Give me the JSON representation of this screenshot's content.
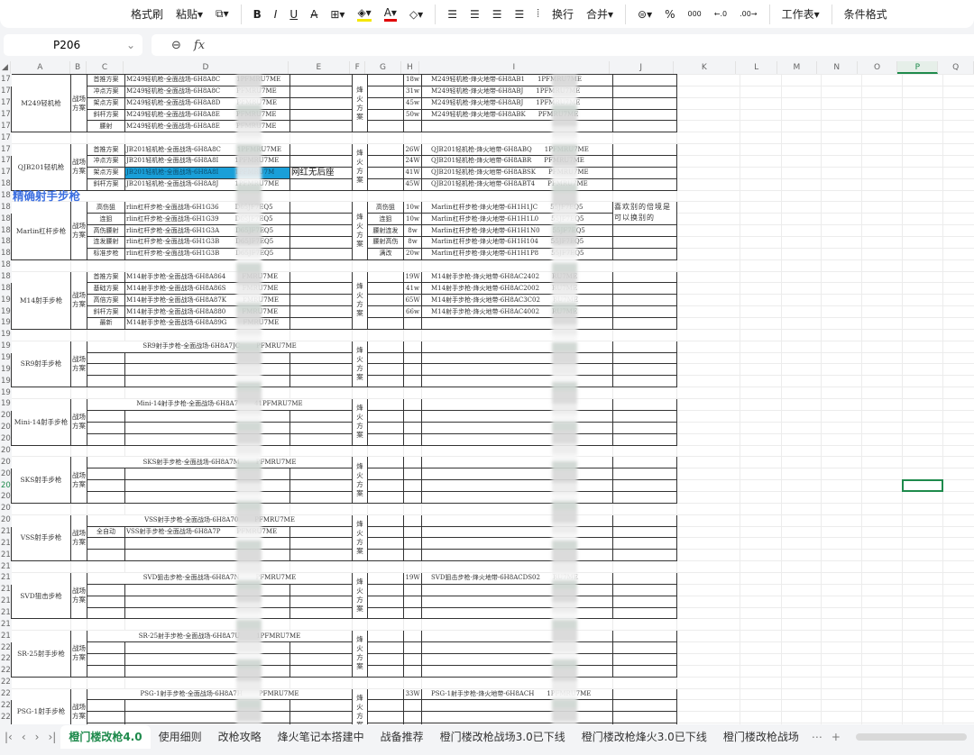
{
  "toolbar": {
    "format_painter": "格式刷",
    "paste": "粘贴▾",
    "copy_icon": "⧉▾",
    "bold": "B",
    "italic": "I",
    "underline": "U",
    "strike": "A̶",
    "border": "⊞▾",
    "fill": "◈▾",
    "font_color": "A▾",
    "clear": "◇▾",
    "align_left": "☰",
    "align_center": "☰",
    "align_right": "☰",
    "justify": "☰",
    "distributed": "⦙",
    "wrap": "换行",
    "merge": "合并▾",
    "number_format": "⊜▾",
    "percent": "%",
    "thousands": "000",
    "inc_decimal": "←.0",
    "dec_decimal": ".00→",
    "worksheet": "工作表▾",
    "conditional_format": "条件格式"
  },
  "formula_bar": {
    "cell_ref": "P206",
    "dropdown": "⌄",
    "zoom_icon": "⊖",
    "fx": "fx",
    "value": ""
  },
  "columns": [
    "A",
    "B",
    "C",
    "D",
    "E",
    "F",
    "G",
    "H",
    "I",
    "J",
    "K",
    "L",
    "M",
    "N",
    "O",
    "P",
    "Q"
  ],
  "selected_column": "P",
  "selected_row": 206,
  "section_title": {
    "row": 181,
    "text": "精确射手步枪"
  },
  "battle_label": "战场方案",
  "beacon_label": "烽火方案",
  "blocks": [
    {
      "name": "M249轻机枪",
      "start": 171,
      "rows": [
        {
          "plan": "首推方案",
          "pre": "M249轻机枪-全面战场-6H8A8C",
          "suf": "1PFMRU7ME",
          "price": "18w",
          "fpre": "M249轻机枪-烽火地带-6H8AB1",
          "fsuf": "1PFMRU7ME"
        },
        {
          "plan": "冲点方案",
          "pre": "M249轻机枪-全面战场-6H8A8C",
          "suf": "PFMRU7ME",
          "price": "31w",
          "fpre": "M249轻机枪-烽火地带-6H8ABJ",
          "fsuf": "1PFMRU7ME"
        },
        {
          "plan": "架点方案",
          "pre": "M249轻机枪-全面战场-6H8A8D",
          "suf": "PFMRU7ME",
          "price": "45w",
          "fpre": "M249轻机枪-烽火地带-6H8ABJ",
          "fsuf": "1PFMRU7ME"
        },
        {
          "plan": "斜杆方案",
          "pre": "M249轻机枪-全面战场-6H8A8E",
          "suf": "PFMRU7ME",
          "price": "50w",
          "fpre": "M249轻机枪-烽火地带-6H8ABK",
          "fsuf": "PFMRU7ME"
        },
        {
          "plan": "腰射",
          "pre": "M249轻机枪-全面战场-6H8A8E",
          "suf": "PFMRU7ME"
        }
      ]
    },
    {
      "name": "QJB201轻机枪",
      "start": 177,
      "rows": [
        {
          "plan": "首推方案",
          "pre": "JB201轻机枪-全面战场-6H8A8C",
          "suf": "1PFMRU7ME",
          "price": "26W",
          "fpre": "QJB201轻机枪-烽火地带-6H8ABQ",
          "fsuf": "1PFMRU7ME"
        },
        {
          "plan": "冲点方案",
          "pre": "JB201轻机枪-全面战场-6H8A8I",
          "suf": "1PFMRU7ME",
          "price": "24W",
          "fpre": "QJB201轻机枪-烽火地带-6H8ABR",
          "fsuf": "PFMRU7ME"
        },
        {
          "plan": "架点方案",
          "pre": "JB201轻机枪-全面战场-6H8A8I",
          "suf": "1PFMRU7M",
          "highlight": true,
          "comment": "网红无后座",
          "price": "41W",
          "fpre": "QJB201轻机枪-烽火地带-6H8ABSK",
          "fsuf": "PFMRU7ME"
        },
        {
          "plan": "斜杆方案",
          "pre": "JB201轻机枪-全面战场-6H8A8J",
          "suf": "1PFMRU7ME",
          "price": "45W",
          "fpre": "QJB201轻机枪-烽火地带-6H8ABT4",
          "fsuf": "PFMRU7ME"
        }
      ]
    },
    {
      "name": "Marlin杠杆步枪",
      "start": 182,
      "note": "喜欢别的倍境是可以换别的",
      "rows": [
        {
          "plan": "高伤狙",
          "pre": "rlin杠杆步枪-全面战场-6H1G36",
          "suf": "D65JF7EQ5",
          "fplan": "高伤狙",
          "price": "10w",
          "fpre": "Marlin杠杆步枪-烽火地带-6H1H1JC",
          "fsuf": "55JF7EQ5"
        },
        {
          "plan": "连狙",
          "pre": "rlin杠杆步枪-全面战场-6H1G39",
          "suf": "D65JF7EQ5",
          "fplan": "连狙",
          "price": "10w",
          "fpre": "Marlin杠杆步枪-烽火地带-6H1H1L0",
          "fsuf": "55JF7EQ5"
        },
        {
          "plan": "高伤腰射",
          "pre": "rlin杠杆步枪-全面战场-6H1G3A",
          "suf": "D65JF7EQ5",
          "fplan": "腰射连发",
          "price": "8w",
          "fpre": "Marlin杠杆步枪-烽火地带-6H1H1N0",
          "fsuf": "55JF7EQ5"
        },
        {
          "plan": "连发腰射",
          "pre": "rlin杠杆步枪-全面战场-6H1G3B",
          "suf": "D65JF7EQ5",
          "fplan": "腰射高伤",
          "price": "8w",
          "fpre": "Marlin杠杆步枪-烽火地带-6H1H104",
          "fsuf": "55JF7EQ5"
        },
        {
          "plan": "标准步枪",
          "pre": "rlin杠杆步枪-全面战场-6H1G3B",
          "suf": "D65JF7EQ5",
          "fplan": "满改",
          "price": "20w",
          "fpre": "Marlin杠杆步枪-烽火地带-6H1H1P8",
          "fsuf": "55JF7EQ5"
        }
      ]
    },
    {
      "name": "M14射手步枪",
      "start": 188,
      "rows": [
        {
          "plan": "首推方案",
          "pre": "M14射手步枪-全面战场-6H8A864",
          "suf": "FMRU7ME",
          "price": "19W",
          "fpre": "M14射手步枪-烽火地带-6H8AC2402",
          "fsuf": "RU7ME"
        },
        {
          "plan": "基础方案",
          "pre": "M14射手步枪-全面战场-6H8A86S",
          "suf": "FMRU7ME",
          "price": "41w",
          "fpre": "M14射手步枪-烽火地带-6H8AC2002",
          "fsuf": "RU7ME"
        },
        {
          "plan": "高倍方案",
          "pre": "M14射手步枪-全面战场-6H8A87K",
          "suf": "FMRU7ME",
          "price": "65W",
          "fpre": "M14射手步枪-烽火地带-6H8AC3C02",
          "fsuf": "RU7ME"
        },
        {
          "plan": "斜杆方案",
          "pre": "M14射手步枪-全面战场-6H8A880",
          "suf": "FMRU7ME",
          "price": "66w",
          "fpre": "M14射手步枪-烽火地带-6H8AC4002",
          "fsuf": "RU7ME"
        },
        {
          "plan": "最新",
          "pre": "M14射手步枪-全面战场-6H8A89G",
          "suf": "FMRU7ME"
        }
      ]
    },
    {
      "name": "SR9射手步枪",
      "start": 194,
      "rows": [
        {
          "merged": true,
          "pre": "SR9射手步枪-全面战场-6H8A7JC",
          "suf": "PFMRU7ME"
        },
        {},
        {},
        {}
      ]
    },
    {
      "name": "Mini-14射手步枪",
      "start": 199,
      "rows": [
        {
          "merged": true,
          "pre": "Mini-14射手步枪-全面战场-6H8A7",
          "suf": "41PFMRU7ME"
        },
        {},
        {},
        {}
      ]
    },
    {
      "name": "SKS射手步枪",
      "start": 204,
      "rows": [
        {
          "merged": true,
          "pre": "SKS射手步枪-全面战场-6H8A7M",
          "suf": "PFMRU7ME"
        },
        {},
        {},
        {}
      ]
    },
    {
      "name": "VSS射手步枪",
      "start": 209,
      "rows": [
        {
          "merged": true,
          "pre": "VSS射手步枪-全面战场-6H8A70",
          "suf": "PFMRU7ME"
        },
        {
          "plan": "全自动",
          "pre": "VSS射手步枪-全面战场-6H8A7P",
          "suf": "PFMRU7ME"
        },
        {},
        {}
      ]
    },
    {
      "name": "SVD狙击步枪",
      "start": 214,
      "rows": [
        {
          "merged": true,
          "pre": "SVD狙击步枪-全面战场-6H8A7N",
          "suf": "PFMRU7ME",
          "price": "19W",
          "fpre": "SVD狙击步枪-烽火地带-6H8ACDS02",
          "fsuf": "RU7ME"
        },
        {},
        {},
        {}
      ]
    },
    {
      "name": "SR-25射手步枪",
      "start": 219,
      "rows": [
        {
          "merged": true,
          "pre": "SR-25射手步枪-全面战场-6H8A7U",
          "suf": "1PFMRU7ME"
        },
        {},
        {},
        {}
      ]
    },
    {
      "name": "PSG-1射手步枪",
      "start": 224,
      "rows": [
        {
          "merged": true,
          "pre": "PSG-1射手步枪-全面战场-6H8A7H",
          "suf": "PFMRU7ME",
          "price": "33W",
          "fpre": "PSG-1射手步枪-烽火地带-6H8ACH",
          "fsuf": "1PFMRU7ME"
        },
        {},
        {},
        {}
      ]
    }
  ],
  "tabs": {
    "nav": [
      "|‹",
      "‹",
      "›",
      "›|"
    ],
    "sheets": [
      "橙门楼改枪4.0",
      "使用细则",
      "改枪攻略",
      "烽火笔记本搭建中",
      "战备推荐",
      "橙门楼改枪战场3.0已下线",
      "橙门楼改枪烽火3.0已下线",
      "橙门楼改枪战场"
    ],
    "active": 0,
    "more": "⋯",
    "add": "+"
  }
}
